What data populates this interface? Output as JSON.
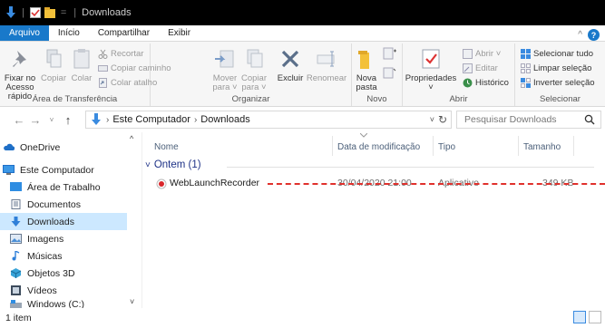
{
  "titlebar": {
    "title": "Downloads",
    "separator": "="
  },
  "ribbon_tabs": {
    "file": "Arquivo",
    "home": "Início",
    "share": "Compartilhar",
    "view": "Exibir",
    "help": "?",
    "collapse": "^"
  },
  "ribbon": {
    "clipboard": {
      "label": "Área de Transferência",
      "pin_line1": "Fixar no",
      "pin_line2": "Acesso rápido",
      "copy": "Copiar",
      "paste": "Colar",
      "cut": "Recortar",
      "copy_path": "Copiar caminho",
      "paste_shortcut": "Colar atalho"
    },
    "organize": {
      "label": "Organizar",
      "move_line1": "Mover",
      "move_line2": "para ˅",
      "copy_line1": "Copiar",
      "copy_line2": "para ˅",
      "delete": "Excluir",
      "rename": "Renomear"
    },
    "new": {
      "label": "Novo",
      "new_folder_line1": "Nova",
      "new_folder_line2": "pasta"
    },
    "open": {
      "label": "Abrir",
      "properties": "Propriedades",
      "open": "Abrir ˅",
      "edit": "Editar",
      "history": "Histórico"
    },
    "select": {
      "label": "Selecionar",
      "select_all": "Selecionar tudo",
      "select_none": "Limpar seleção",
      "invert": "Inverter seleção"
    }
  },
  "address": {
    "crumb1": "Este Computador",
    "crumb2": "Downloads",
    "search_placeholder": "Pesquisar Downloads"
  },
  "nav": {
    "items": [
      {
        "label": "OneDrive"
      },
      {
        "label": "Este Computador"
      },
      {
        "label": "Área de Trabalho"
      },
      {
        "label": "Documentos"
      },
      {
        "label": "Downloads"
      },
      {
        "label": "Imagens"
      },
      {
        "label": "Músicas"
      },
      {
        "label": "Objetos 3D"
      },
      {
        "label": "Vídeos"
      },
      {
        "label": "Windows (C:)"
      }
    ]
  },
  "columns": {
    "name": "Nome",
    "date": "Data de modificação",
    "type": "Tipo",
    "size": "Tamanho"
  },
  "group": {
    "label": "Ontem (1)"
  },
  "files": [
    {
      "name": "WebLaunchRecorder",
      "date": "30/04/2020 21:00",
      "type": "Aplicativo",
      "size": "349 KB"
    }
  ],
  "status": {
    "count": "1 item"
  },
  "colors": {
    "accent": "#1979ca",
    "selection": "#cce8ff",
    "strike": "#e0302c"
  }
}
